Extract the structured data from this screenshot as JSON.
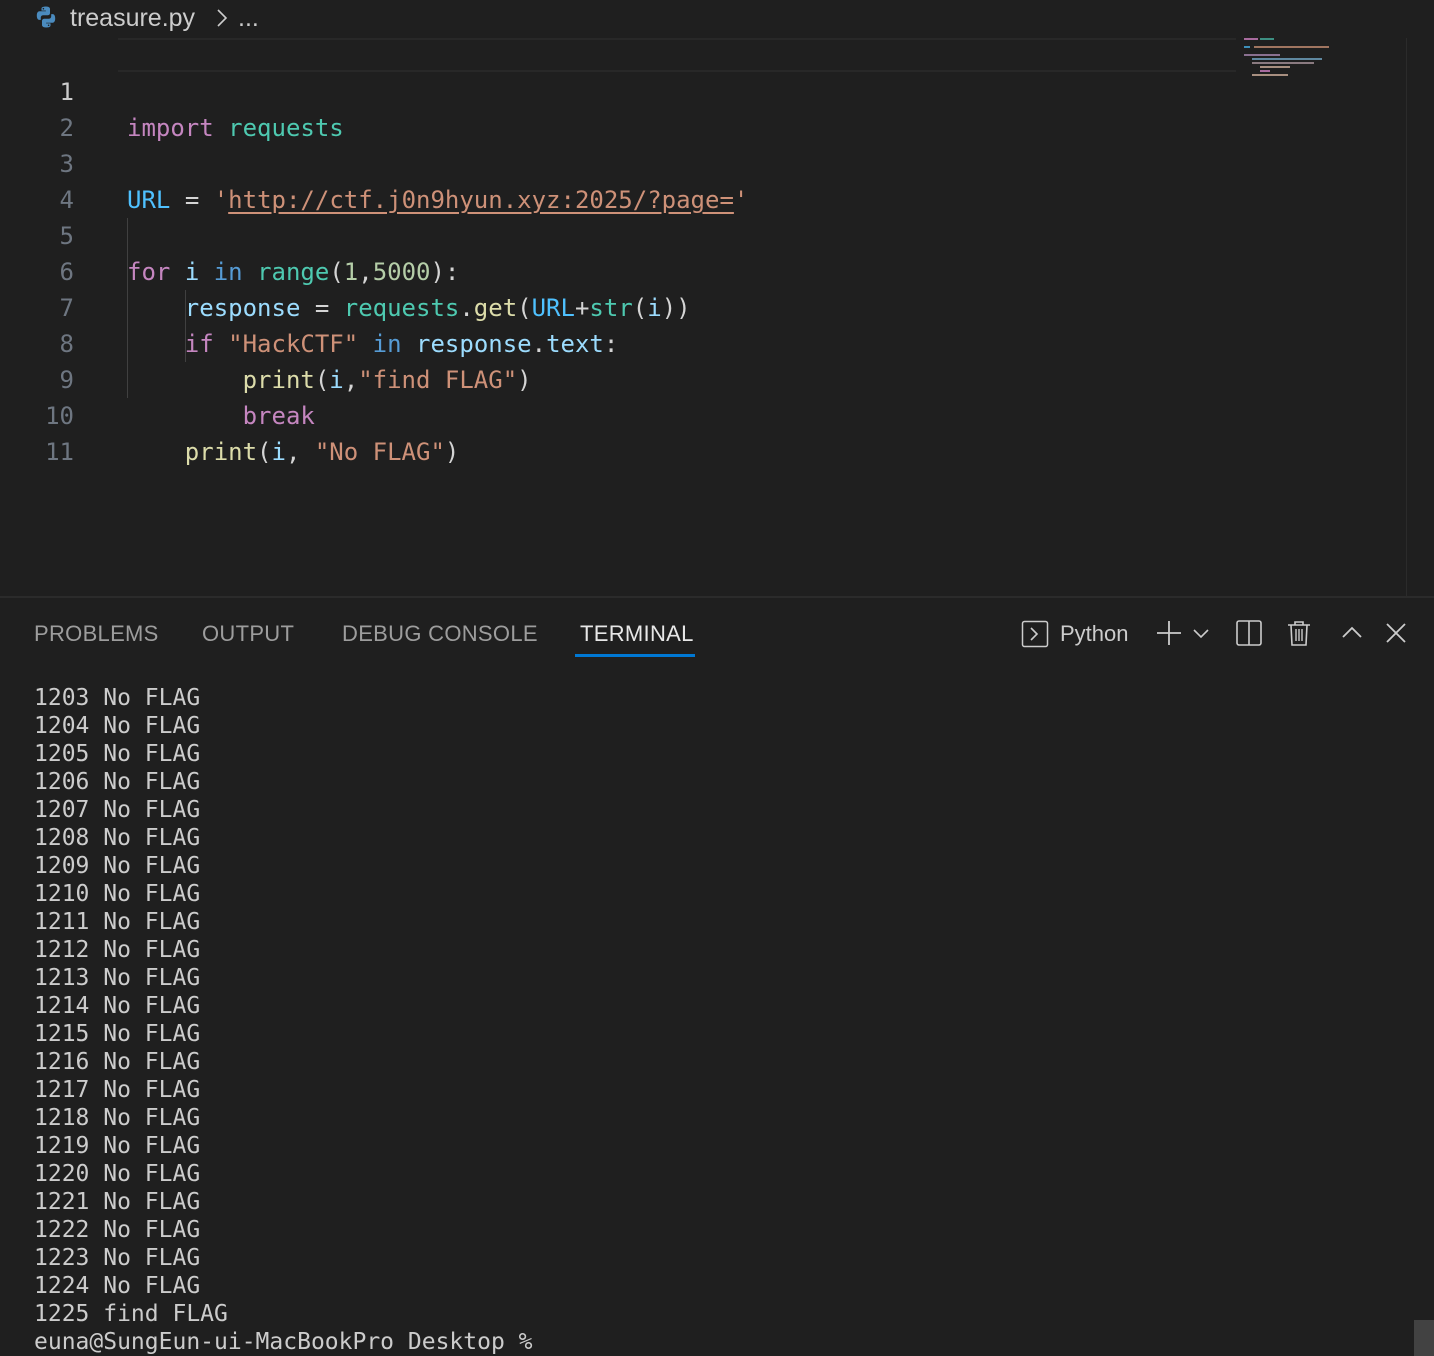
{
  "breadcrumb": {
    "file_icon": "python-icon",
    "file_name": "treasure.py",
    "separator_icon": "chevron-right-icon",
    "ellipsis": "..."
  },
  "editor": {
    "line_numbers": [
      "1",
      "2",
      "3",
      "4",
      "5",
      "6",
      "7",
      "8",
      "9",
      "10",
      "11"
    ],
    "active_line": "1",
    "code": {
      "l1": {
        "kw": "import",
        "mod": "requests"
      },
      "l3": {
        "name": "URL",
        "eq": "=",
        "q1": "'",
        "url": "http://ctf.j0n9hyun.xyz:2025/?page=",
        "q2": "'"
      },
      "l5": {
        "kw_for": "for",
        "var": "i",
        "kw_in": "in",
        "fn": "range",
        "p1": "(",
        "n1": "1",
        "comma": ",",
        "n2": "5000",
        "p2": "):"
      },
      "l6": {
        "var": "response",
        "eq": "=",
        "mod": "requests",
        "dot": ".",
        "fn": "get",
        "p1": "(",
        "const": "URL",
        "plus": "+",
        "builtin": "str",
        "p2": "(",
        "arg": "i",
        "p3": "))"
      },
      "l7": {
        "kw_if": "if",
        "str": "\"HackCTF\"",
        "kw_in": "in",
        "var": "response",
        "dot": ".",
        "attr": "text",
        "colon": ":"
      },
      "l8": {
        "fn": "print",
        "p1": "(",
        "arg": "i",
        "comma": ",",
        "str": "\"find FLAG\"",
        "p2": ")"
      },
      "l9": {
        "kw": "break"
      },
      "l10": {
        "fn": "print",
        "p1": "(",
        "arg": "i",
        "comma": ",",
        "str": "\"No FLAG\"",
        "p2": ")"
      }
    }
  },
  "panel": {
    "tabs": {
      "problems": "PROBLEMS",
      "output": "OUTPUT",
      "debug_console": "DEBUG CONSOLE",
      "terminal": "TERMINAL"
    },
    "active_tab": "TERMINAL",
    "terminal_profile": "Python",
    "actions": [
      "terminal-icon",
      "plus-icon",
      "chevron-down-icon",
      "split-icon",
      "trash-icon",
      "chevron-up-icon",
      "close-icon"
    ],
    "accent_color": "#0078d4"
  },
  "terminal": {
    "lines": [
      "1203 No FLAG",
      "1204 No FLAG",
      "1205 No FLAG",
      "1206 No FLAG",
      "1207 No FLAG",
      "1208 No FLAG",
      "1209 No FLAG",
      "1210 No FLAG",
      "1211 No FLAG",
      "1212 No FLAG",
      "1213 No FLAG",
      "1214 No FLAG",
      "1215 No FLAG",
      "1216 No FLAG",
      "1217 No FLAG",
      "1218 No FLAG",
      "1219 No FLAG",
      "1220 No FLAG",
      "1221 No FLAG",
      "1222 No FLAG",
      "1223 No FLAG",
      "1224 No FLAG",
      "1225 find FLAG"
    ],
    "prompt": "euna@SungEun-ui-MacBookPro Desktop %"
  }
}
